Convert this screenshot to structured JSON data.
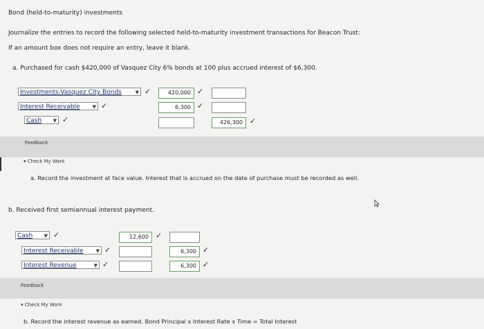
{
  "header": {
    "title": "Bond (held-to-maturity) investments",
    "instructions": "Journalize the entries to record the following selected held-to-maturity investment transactions for Beacon Trust:",
    "note": "If an amount box does not require an entry, leave it blank."
  },
  "part_a": {
    "prompt": "a.  Purchased for cash $420,000 of Vasquez City 6% bonds at 100 plus accrued interest of $6,300.",
    "rows": [
      {
        "account": "Investments-Vasquez City Bonds",
        "debit": "420,000",
        "credit": ""
      },
      {
        "account": "Interest Receivable",
        "debit": "6,300",
        "credit": ""
      },
      {
        "account": "Cash",
        "debit": "",
        "credit": "426,300"
      }
    ],
    "feedback_label": "Feedback",
    "check_my_work": "Check My Work",
    "feedback_text": "a. Record the investment at face value. Interest that is accrued on the date of purchase must be recorded as well."
  },
  "part_b": {
    "prompt": "b.  Received first semiannual interest payment.",
    "rows": [
      {
        "account": "Cash",
        "debit": "12,600",
        "credit": ""
      },
      {
        "account": "Interest Receivable",
        "debit": "",
        "credit": "6,300"
      },
      {
        "account": "Interest Revenue",
        "debit": "",
        "credit": "6,300"
      }
    ],
    "feedback_label": "Feedback",
    "check_my_work": "Check My Work",
    "feedback_text": "b. Record the interest revenue as earned. Bond Principal x Interest Rate x Time = Total Interest"
  },
  "icons": {
    "check": "checkmark-icon",
    "dropdown": "dropdown-arrow-icon",
    "cursor": "mouse-cursor-icon"
  },
  "colors": {
    "band": "#d9d9d7",
    "link": "#1f2f6b"
  }
}
